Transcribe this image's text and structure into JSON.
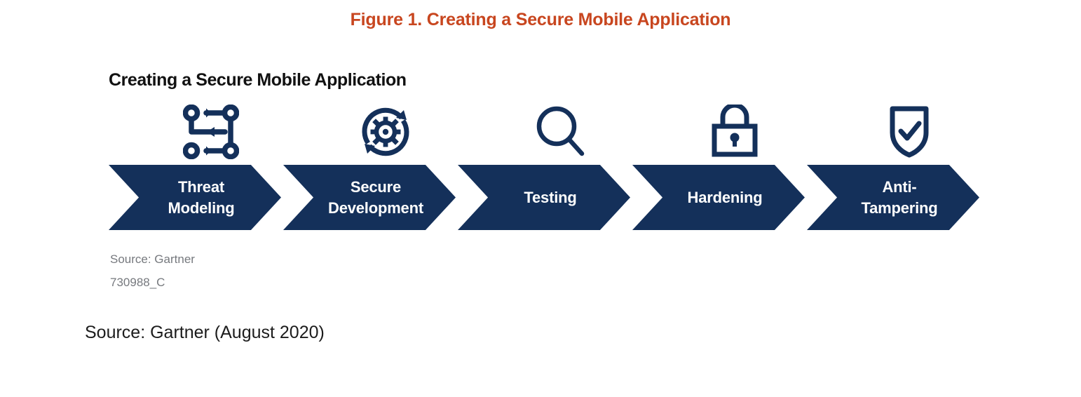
{
  "figure": {
    "caption": "Figure 1. Creating a Secure Mobile Application",
    "caption_color": "#c8461f"
  },
  "graphic": {
    "heading": "Creating a Secure Mobile Application",
    "accent_color": "#14305a",
    "steps": [
      {
        "label": "Threat\nModeling",
        "line1": "Threat",
        "line2": "Modeling",
        "icon": "threat-model-network-icon"
      },
      {
        "label": "Secure\nDevelopment",
        "line1": "Secure",
        "line2": "Development",
        "icon": "gear-refresh-icon"
      },
      {
        "label": "Testing",
        "line1": "Testing",
        "line2": "",
        "icon": "magnifying-glass-icon"
      },
      {
        "label": "Hardening",
        "line1": "Hardening",
        "line2": "",
        "icon": "padlock-icon"
      },
      {
        "label": "Anti-\nTampering",
        "line1": "Anti-",
        "line2": "Tampering",
        "icon": "shield-check-icon"
      }
    ],
    "source_note": "Source: Gartner",
    "figure_id": "730988_C"
  },
  "bottom_source": "Source: Gartner (August 2020)"
}
